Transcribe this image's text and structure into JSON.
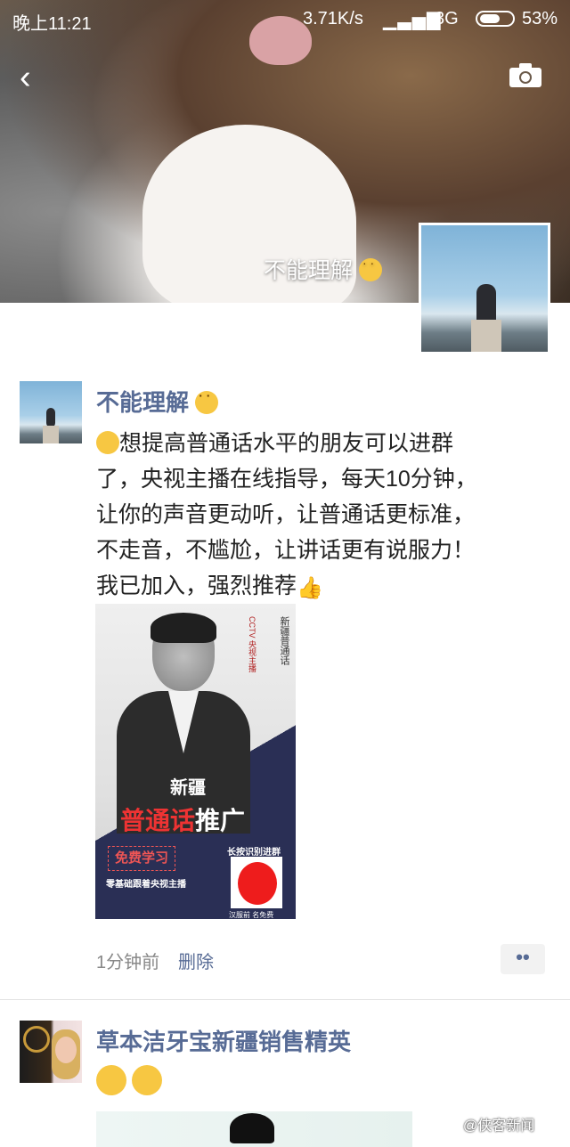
{
  "status_bar": {
    "time": "晚上11:21",
    "speed": "3.71K/s",
    "network": "3G",
    "battery": "53%"
  },
  "header": {
    "back_icon": "chevron-left-icon",
    "camera_icon": "camera-icon",
    "cover_name": "不能理解"
  },
  "post": {
    "username": "不能理解",
    "lines": [
      "想提高普通话水平的朋友可以进群",
      "了，央视主播在线指导，每天10分钟，",
      "让你的声音更动听，让普通话更标准，",
      "不走音，不尴尬，让讲话更有说服力！",
      "我已加入，强烈推荐"
    ],
    "poster": {
      "vertical_title": "新疆普通话",
      "vertical_sub": "CCTV 央视主播",
      "line1": "新疆",
      "line2_red": "普通话",
      "line2_white": "推广",
      "free": "免费学习",
      "sub": "零基础跟着央视主播",
      "qr_label": "长按识别进群",
      "footer": "汉服前 名免费"
    },
    "time_ago": "1分钟前",
    "delete": "删除",
    "more": "••"
  },
  "post2": {
    "username": "草本洁牙宝新疆销售精英"
  },
  "watermark": "@侠客新闻"
}
